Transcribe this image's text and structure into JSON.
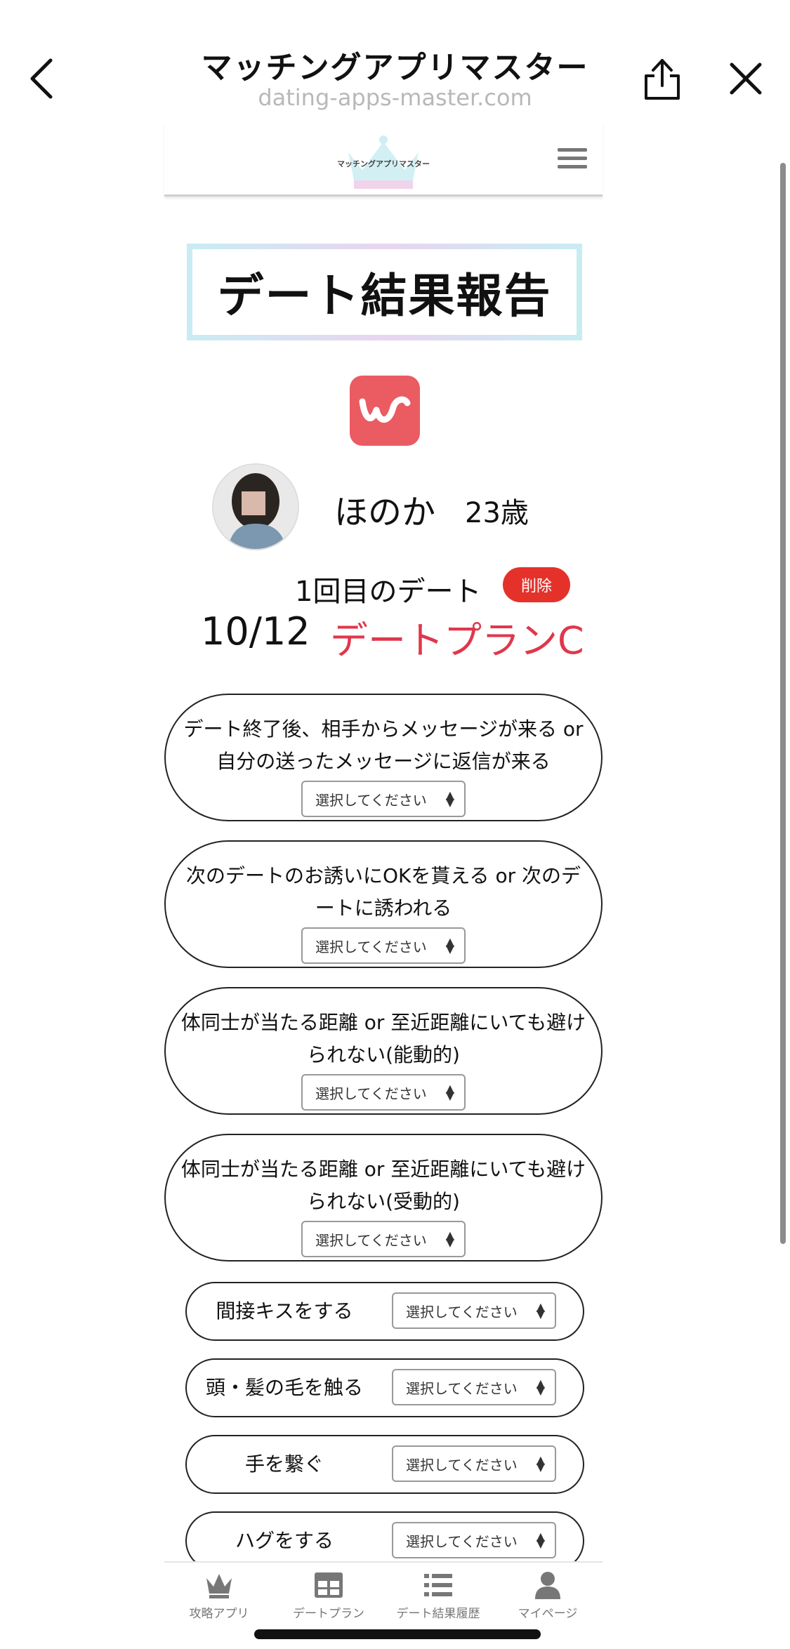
{
  "browser": {
    "title": "マッチングアプリマスター",
    "url": "dating-apps-master.com",
    "back_icon": "chevron-left-icon",
    "share_icon": "share-icon",
    "close_icon": "close-icon"
  },
  "header": {
    "logo_text": "マッチングアプリマスター",
    "menu_icon": "hamburger-icon"
  },
  "page": {
    "title": "デート結果報告",
    "app_icon": "w-app-icon",
    "accent_color": "#ea5b62"
  },
  "profile": {
    "name": "ほのか",
    "age": "23歳"
  },
  "date": {
    "count_label": "1回目のデート",
    "delete_label": "削除",
    "date": "10/12",
    "plan": "デートプランC",
    "plan_color": "#e0374b"
  },
  "questions_large": [
    {
      "text": "デート終了後、相手からメッセージが来る or 自分の送ったメッセージに返信が来る",
      "select": "選択してください"
    },
    {
      "text": "次のデートのお誘いにOKを貰える or 次のデートに誘われる",
      "select": "選択してください"
    },
    {
      "text": "体同士が当たる距離 or 至近距離にいても避けられない(能動的)",
      "select": "選択してください"
    },
    {
      "text": "体同士が当たる距離 or 至近距離にいても避けられない(受動的)",
      "select": "選択してください"
    }
  ],
  "questions_small": [
    {
      "text": "間接キスをする",
      "select": "選択してください"
    },
    {
      "text": "頭・髪の毛を触る",
      "select": "選択してください"
    },
    {
      "text": "手を繋ぐ",
      "select": "選択してください"
    },
    {
      "text": "ハグをする",
      "select": "選択してください"
    }
  ],
  "tabs": [
    {
      "label": "攻略アプリ",
      "icon": "crown-icon"
    },
    {
      "label": "デートプラン",
      "icon": "grid-icon"
    },
    {
      "label": "デート結果履歴",
      "icon": "list-icon"
    },
    {
      "label": "マイページ",
      "icon": "user-icon"
    }
  ]
}
